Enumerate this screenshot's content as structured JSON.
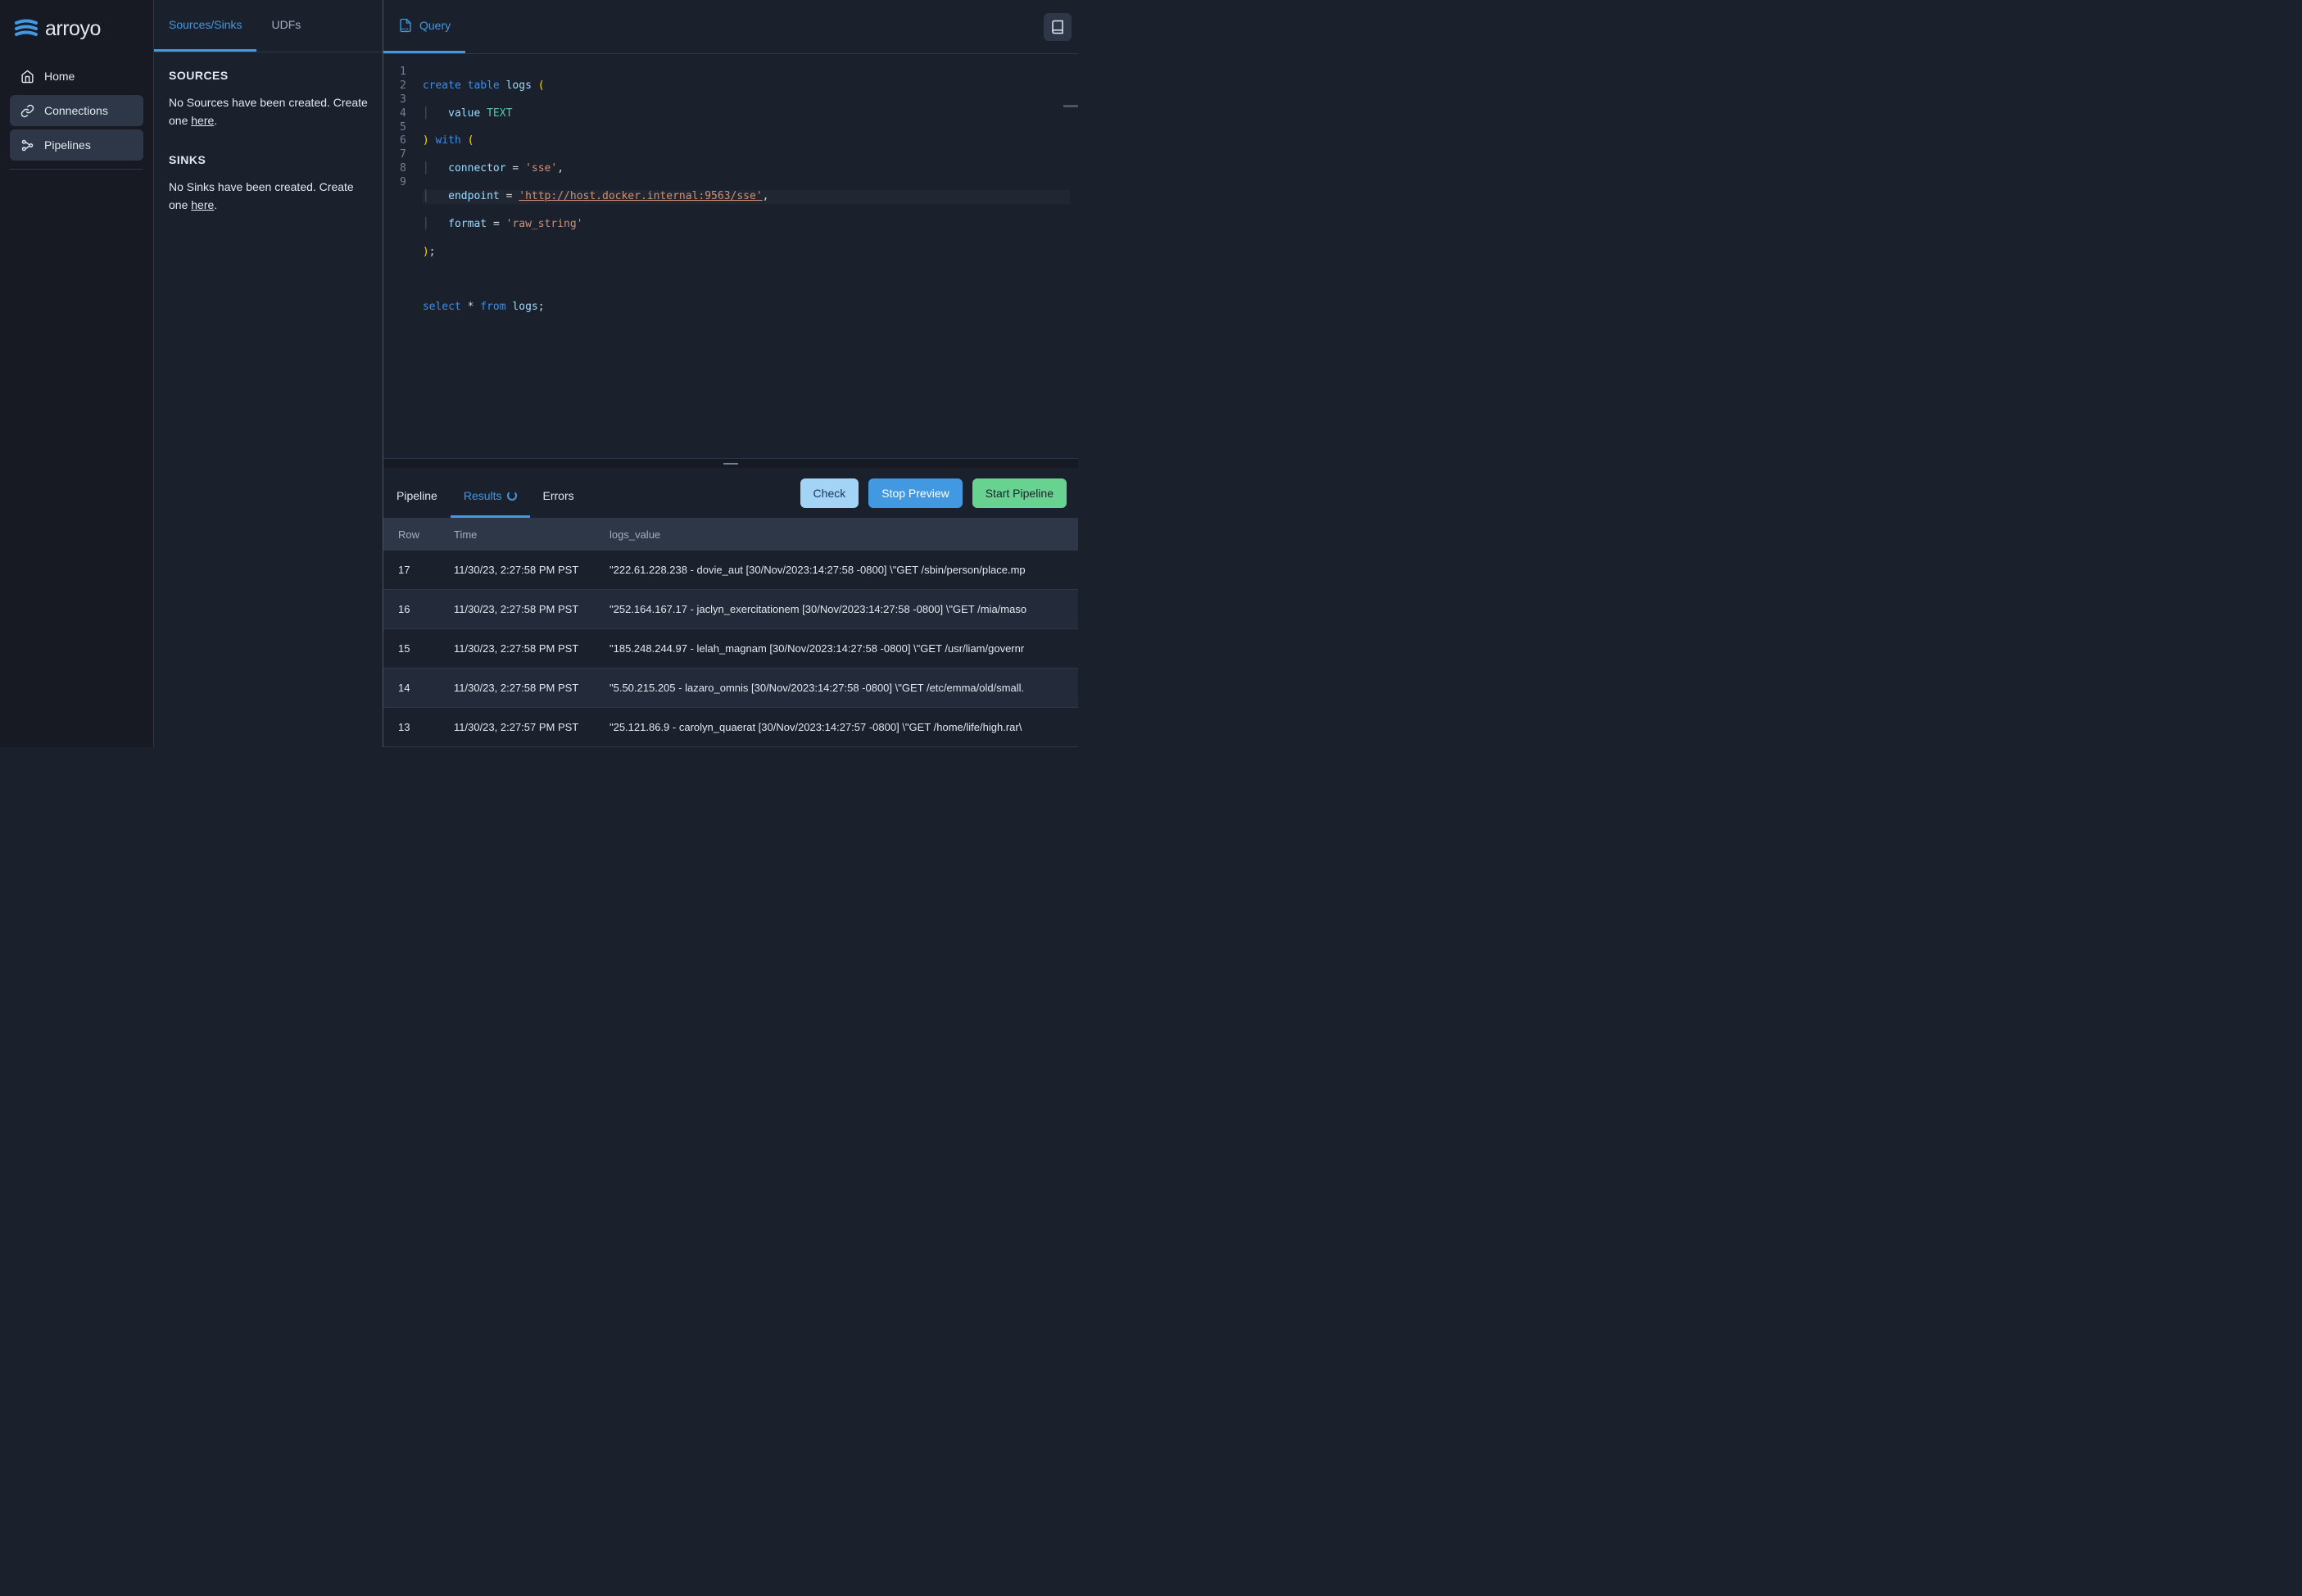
{
  "brand": {
    "name": "arroyo"
  },
  "nav": {
    "items": [
      {
        "label": "Home",
        "active": false
      },
      {
        "label": "Connections",
        "active": true
      },
      {
        "label": "Pipelines",
        "active": true
      }
    ]
  },
  "left_panel": {
    "tabs": [
      {
        "label": "Sources/Sinks",
        "active": true
      },
      {
        "label": "UDFs",
        "active": false
      }
    ],
    "sources_header": "SOURCES",
    "sources_empty_prefix": "No Sources have been created. Create one ",
    "sources_empty_link": "here",
    "sources_empty_suffix": ".",
    "sinks_header": "SINKS",
    "sinks_empty_prefix": "No Sinks have been created. Create one ",
    "sinks_empty_link": "here",
    "sinks_empty_suffix": "."
  },
  "main_tabs": [
    {
      "label": "Query",
      "active": true
    }
  ],
  "editor": {
    "line_numbers": [
      "1",
      "2",
      "3",
      "4",
      "5",
      "6",
      "7",
      "8",
      "9"
    ],
    "sql_tokens": {
      "l1": {
        "create": "create",
        "table": "table",
        "logs": "logs"
      },
      "l2": {
        "value": "value",
        "text_t": "TEXT"
      },
      "l3": {
        "with": "with"
      },
      "l4": {
        "connector": "connector",
        "sse": "'sse'"
      },
      "l5": {
        "endpoint": "endpoint",
        "url": "'http://host.docker.internal:9563/sse'"
      },
      "l6": {
        "format": "format",
        "raw": "'raw_string'"
      },
      "l9": {
        "select": "select",
        "from": "from",
        "logs": "logs"
      }
    }
  },
  "bottom": {
    "tabs": [
      {
        "label": "Pipeline",
        "active": false
      },
      {
        "label": "Results",
        "active": true,
        "spinner": true
      },
      {
        "label": "Errors",
        "active": false
      }
    ],
    "buttons": {
      "check": "Check",
      "stop": "Stop Preview",
      "start": "Start Pipeline"
    },
    "columns": [
      "Row",
      "Time",
      "logs_value"
    ],
    "rows": [
      {
        "row": "17",
        "time": "11/30/23, 2:27:58 PM PST",
        "value": "\"222.61.228.238 - dovie_aut [30/Nov/2023:14:27:58 -0800] \\\"GET /sbin/person/place.mp"
      },
      {
        "row": "16",
        "time": "11/30/23, 2:27:58 PM PST",
        "value": "\"252.164.167.17 - jaclyn_exercitationem [30/Nov/2023:14:27:58 -0800] \\\"GET /mia/maso"
      },
      {
        "row": "15",
        "time": "11/30/23, 2:27:58 PM PST",
        "value": "\"185.248.244.97 - lelah_magnam [30/Nov/2023:14:27:58 -0800] \\\"GET /usr/liam/governr"
      },
      {
        "row": "14",
        "time": "11/30/23, 2:27:58 PM PST",
        "value": "\"5.50.215.205 - lazaro_omnis [30/Nov/2023:14:27:58 -0800] \\\"GET /etc/emma/old/small."
      },
      {
        "row": "13",
        "time": "11/30/23, 2:27:57 PM PST",
        "value": "\"25.121.86.9 - carolyn_quaerat [30/Nov/2023:14:27:57 -0800] \\\"GET /home/life/high.rar\\"
      }
    ]
  },
  "colors": {
    "accent_blue": "#4299e1",
    "accent_green": "#68d391",
    "bg_dark": "#1a202c",
    "bg_darker": "#171923",
    "bg_panel": "#2d3748"
  }
}
